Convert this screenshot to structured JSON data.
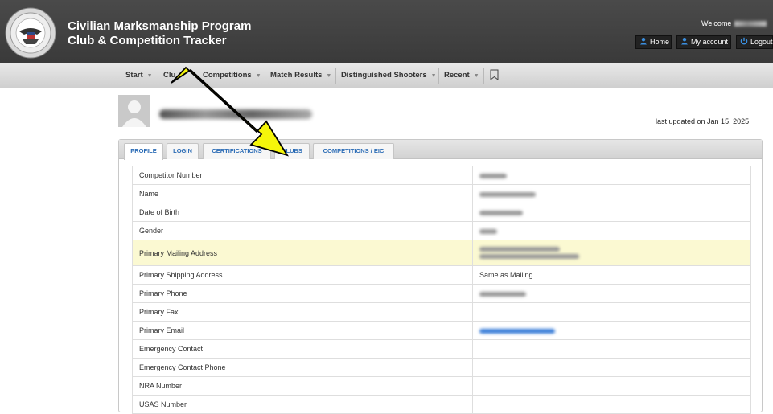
{
  "header": {
    "title_line1": "Civilian Marksmanship Program",
    "title_line2": "Club & Competition Tracker",
    "welcome": "Welcome",
    "buttons": {
      "home": "Home",
      "my_account": "My account",
      "logout": "Logout"
    }
  },
  "nav": {
    "items": [
      "Start",
      "Clu",
      "Competitions",
      "Match Results",
      "Distinguished Shooters",
      "Recent"
    ]
  },
  "profile": {
    "last_updated": "last updated on Jan 15, 2025",
    "tabs": [
      "PROFILE",
      "LOGIN",
      "CERTIFICATIONS",
      "CLUBS",
      "COMPETITIONS / EIC"
    ],
    "active_tab": "PROFILE",
    "rows": [
      {
        "label": "Competitor Number",
        "value": ""
      },
      {
        "label": "Name",
        "value": ""
      },
      {
        "label": "Date of Birth",
        "value": ""
      },
      {
        "label": "Gender",
        "value": ""
      },
      {
        "label": "Primary Mailing Address",
        "value": ""
      },
      {
        "label": "Primary Shipping Address",
        "value": "Same as Mailing"
      },
      {
        "label": "Primary Phone",
        "value": ""
      },
      {
        "label": "Primary Fax",
        "value": ""
      },
      {
        "label": "Primary Email",
        "value": ""
      },
      {
        "label": "Emergency Contact",
        "value": ""
      },
      {
        "label": "Emergency Contact Phone",
        "value": ""
      },
      {
        "label": "NRA Number",
        "value": ""
      },
      {
        "label": "USAS Number",
        "value": ""
      }
    ]
  },
  "colors": {
    "header_bg": "#3f3f3f",
    "tab_text": "#2a6bb5",
    "highlight_row": "#fbf9d2",
    "arrow_fill": "#f5f50a"
  }
}
